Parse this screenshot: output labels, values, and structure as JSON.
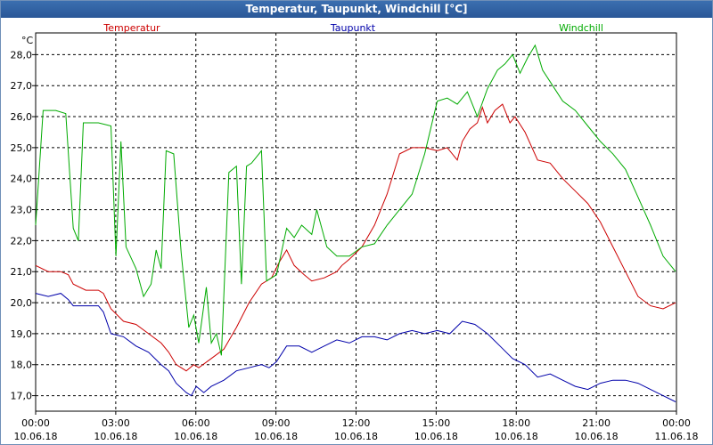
{
  "window": {
    "title": "Temperatur, Taupunkt, Windchill [°C]"
  },
  "chart_data": {
    "type": "line",
    "title": "Temperatur, Taupunkt, Windchill [°C]",
    "ylabel": "°C",
    "ylim": [
      16.5,
      28.7
    ],
    "xlim": [
      0,
      24
    ],
    "x_tick_values": [
      0,
      3,
      6,
      9,
      12,
      15,
      18,
      21,
      24
    ],
    "x_tick_labels": [
      [
        "00:00",
        "10.06.18"
      ],
      [
        "03:00",
        "10.06.18"
      ],
      [
        "06:00",
        "10.06.18"
      ],
      [
        "09:00",
        "10.06.18"
      ],
      [
        "12:00",
        "10.06.18"
      ],
      [
        "15:00",
        "10.06.18"
      ],
      [
        "18:00",
        "10.06.18"
      ],
      [
        "21:00",
        "10.06.18"
      ],
      [
        "00:00",
        "11.06.18"
      ]
    ],
    "y_ticks": [
      17,
      18,
      19,
      20,
      21,
      22,
      23,
      24,
      25,
      26,
      27,
      28
    ],
    "y_tick_labels": [
      "17,0",
      "18,0",
      "19,0",
      "20,0",
      "21,0",
      "22,0",
      "23,0",
      "24,0",
      "25,0",
      "26,0",
      "27,0",
      "28,0"
    ],
    "grid": true,
    "series": [
      {
        "name": "Temperatur",
        "color": "#cc0000",
        "points": [
          [
            0,
            21.2
          ],
          [
            0.5,
            21.0
          ],
          [
            1,
            21.0
          ],
          [
            1.3,
            20.9
          ],
          [
            1.5,
            20.6
          ],
          [
            2,
            20.4
          ],
          [
            2.5,
            20.4
          ],
          [
            2.7,
            20.3
          ],
          [
            3,
            19.8
          ],
          [
            3.5,
            19.4
          ],
          [
            4,
            19.3
          ],
          [
            4.5,
            19.0
          ],
          [
            5,
            18.7
          ],
          [
            5.3,
            18.4
          ],
          [
            5.6,
            18.0
          ],
          [
            6,
            17.8
          ],
          [
            6.3,
            18.0
          ],
          [
            6.5,
            17.9
          ],
          [
            7,
            18.2
          ],
          [
            7.5,
            18.5
          ],
          [
            8,
            19.2
          ],
          [
            8.5,
            20.0
          ],
          [
            9,
            20.6
          ],
          [
            9.4,
            20.8
          ],
          [
            9.7,
            21.3
          ],
          [
            10,
            21.7
          ],
          [
            10.3,
            21.2
          ],
          [
            10.7,
            20.9
          ],
          [
            11,
            20.7
          ],
          [
            11.5,
            20.8
          ],
          [
            12,
            21.0
          ],
          [
            12.2,
            21.2
          ],
          [
            12.5,
            21.4
          ],
          [
            13,
            21.8
          ],
          [
            13.5,
            22.5
          ],
          [
            14,
            23.5
          ],
          [
            14.5,
            24.8
          ],
          [
            15,
            25.0
          ],
          [
            15.5,
            25.0
          ],
          [
            16,
            24.9
          ],
          [
            16.4,
            25.0
          ],
          [
            16.8,
            24.6
          ],
          [
            17,
            25.2
          ],
          [
            17.3,
            25.6
          ],
          [
            17.6,
            25.8
          ],
          [
            17.8,
            26.3
          ],
          [
            18,
            25.8
          ],
          [
            18.3,
            26.2
          ],
          [
            18.6,
            26.4
          ],
          [
            18.9,
            25.8
          ],
          [
            19.1,
            26.0
          ],
          [
            19.5,
            25.5
          ],
          [
            20,
            24.6
          ],
          [
            20.5,
            24.5
          ],
          [
            21,
            24.0
          ],
          [
            21.5,
            23.6
          ],
          [
            22,
            23.2
          ],
          [
            22.5,
            22.6
          ],
          [
            23,
            21.8
          ],
          [
            23.5,
            21.0
          ],
          [
            24,
            20.2
          ],
          [
            24.5,
            19.9
          ],
          [
            25,
            19.8
          ],
          [
            25.5,
            20.0
          ]
        ]
      },
      {
        "name": "Taupunkt",
        "color": "#0000aa",
        "points": [
          [
            0,
            20.3
          ],
          [
            0.5,
            20.2
          ],
          [
            1,
            20.3
          ],
          [
            1.3,
            20.1
          ],
          [
            1.5,
            19.9
          ],
          [
            2,
            19.9
          ],
          [
            2.5,
            19.9
          ],
          [
            2.7,
            19.7
          ],
          [
            3,
            19.0
          ],
          [
            3.5,
            18.9
          ],
          [
            4,
            18.6
          ],
          [
            4.5,
            18.4
          ],
          [
            5,
            18.0
          ],
          [
            5.3,
            17.8
          ],
          [
            5.6,
            17.4
          ],
          [
            6,
            17.1
          ],
          [
            6.2,
            17.0
          ],
          [
            6.4,
            17.3
          ],
          [
            6.7,
            17.1
          ],
          [
            7,
            17.3
          ],
          [
            7.5,
            17.5
          ],
          [
            8,
            17.8
          ],
          [
            8.5,
            17.9
          ],
          [
            9,
            18.0
          ],
          [
            9.3,
            17.9
          ],
          [
            9.6,
            18.1
          ],
          [
            10,
            18.6
          ],
          [
            10.5,
            18.6
          ],
          [
            11,
            18.4
          ],
          [
            11.5,
            18.6
          ],
          [
            12,
            18.8
          ],
          [
            12.5,
            18.7
          ],
          [
            13,
            18.9
          ],
          [
            13.5,
            18.9
          ],
          [
            14,
            18.8
          ],
          [
            14.5,
            19.0
          ],
          [
            15,
            19.1
          ],
          [
            15.5,
            19.0
          ],
          [
            16,
            19.1
          ],
          [
            16.5,
            19.0
          ],
          [
            17,
            19.4
          ],
          [
            17.5,
            19.3
          ],
          [
            18,
            19.0
          ],
          [
            18.5,
            18.6
          ],
          [
            19,
            18.2
          ],
          [
            19.5,
            18.0
          ],
          [
            20,
            17.6
          ],
          [
            20.5,
            17.7
          ],
          [
            21,
            17.5
          ],
          [
            21.5,
            17.3
          ],
          [
            22,
            17.2
          ],
          [
            22.5,
            17.4
          ],
          [
            23,
            17.5
          ],
          [
            23.5,
            17.5
          ],
          [
            24,
            17.4
          ],
          [
            24.5,
            17.2
          ],
          [
            25,
            17.0
          ],
          [
            25.5,
            16.8
          ]
        ]
      },
      {
        "name": "Windchill",
        "color": "#00aa00",
        "points": [
          [
            0,
            22.5
          ],
          [
            0.3,
            26.2
          ],
          [
            0.8,
            26.2
          ],
          [
            1.2,
            26.1
          ],
          [
            1.5,
            22.4
          ],
          [
            1.7,
            22.0
          ],
          [
            1.9,
            25.8
          ],
          [
            2.5,
            25.8
          ],
          [
            3,
            25.7
          ],
          [
            3.2,
            21.5
          ],
          [
            3.4,
            25.2
          ],
          [
            3.6,
            21.8
          ],
          [
            4,
            21.1
          ],
          [
            4.3,
            20.2
          ],
          [
            4.6,
            20.6
          ],
          [
            4.8,
            21.7
          ],
          [
            5,
            21.1
          ],
          [
            5.2,
            24.9
          ],
          [
            5.5,
            24.8
          ],
          [
            5.8,
            21.6
          ],
          [
            6.1,
            19.2
          ],
          [
            6.3,
            19.6
          ],
          [
            6.5,
            18.7
          ],
          [
            6.8,
            20.5
          ],
          [
            7,
            18.7
          ],
          [
            7.2,
            19.0
          ],
          [
            7.4,
            18.3
          ],
          [
            7.7,
            24.2
          ],
          [
            8,
            24.4
          ],
          [
            8.2,
            20.6
          ],
          [
            8.4,
            24.4
          ],
          [
            8.6,
            24.5
          ],
          [
            9,
            24.9
          ],
          [
            9.2,
            20.7
          ],
          [
            9.6,
            20.9
          ],
          [
            10,
            22.4
          ],
          [
            10.3,
            22.1
          ],
          [
            10.6,
            22.5
          ],
          [
            11,
            22.2
          ],
          [
            11.2,
            23.0
          ],
          [
            11.6,
            21.8
          ],
          [
            12,
            21.5
          ],
          [
            12.5,
            21.5
          ],
          [
            13,
            21.8
          ],
          [
            13.5,
            21.9
          ],
          [
            14,
            22.5
          ],
          [
            14.5,
            23.0
          ],
          [
            15,
            23.5
          ],
          [
            15.5,
            24.8
          ],
          [
            16,
            26.5
          ],
          [
            16.4,
            26.6
          ],
          [
            16.8,
            26.4
          ],
          [
            17.2,
            26.8
          ],
          [
            17.6,
            26.0
          ],
          [
            18,
            26.9
          ],
          [
            18.4,
            27.5
          ],
          [
            18.7,
            27.7
          ],
          [
            19,
            28.0
          ],
          [
            19.3,
            27.4
          ],
          [
            19.6,
            27.9
          ],
          [
            19.9,
            28.3
          ],
          [
            20.2,
            27.5
          ],
          [
            20.6,
            27.0
          ],
          [
            21,
            26.5
          ],
          [
            21.5,
            26.2
          ],
          [
            22,
            25.7
          ],
          [
            22.5,
            25.2
          ],
          [
            23,
            24.8
          ],
          [
            23.5,
            24.3
          ],
          [
            24,
            23.4
          ],
          [
            24.5,
            22.5
          ],
          [
            25,
            21.5
          ],
          [
            25.5,
            21.0
          ]
        ]
      }
    ]
  }
}
